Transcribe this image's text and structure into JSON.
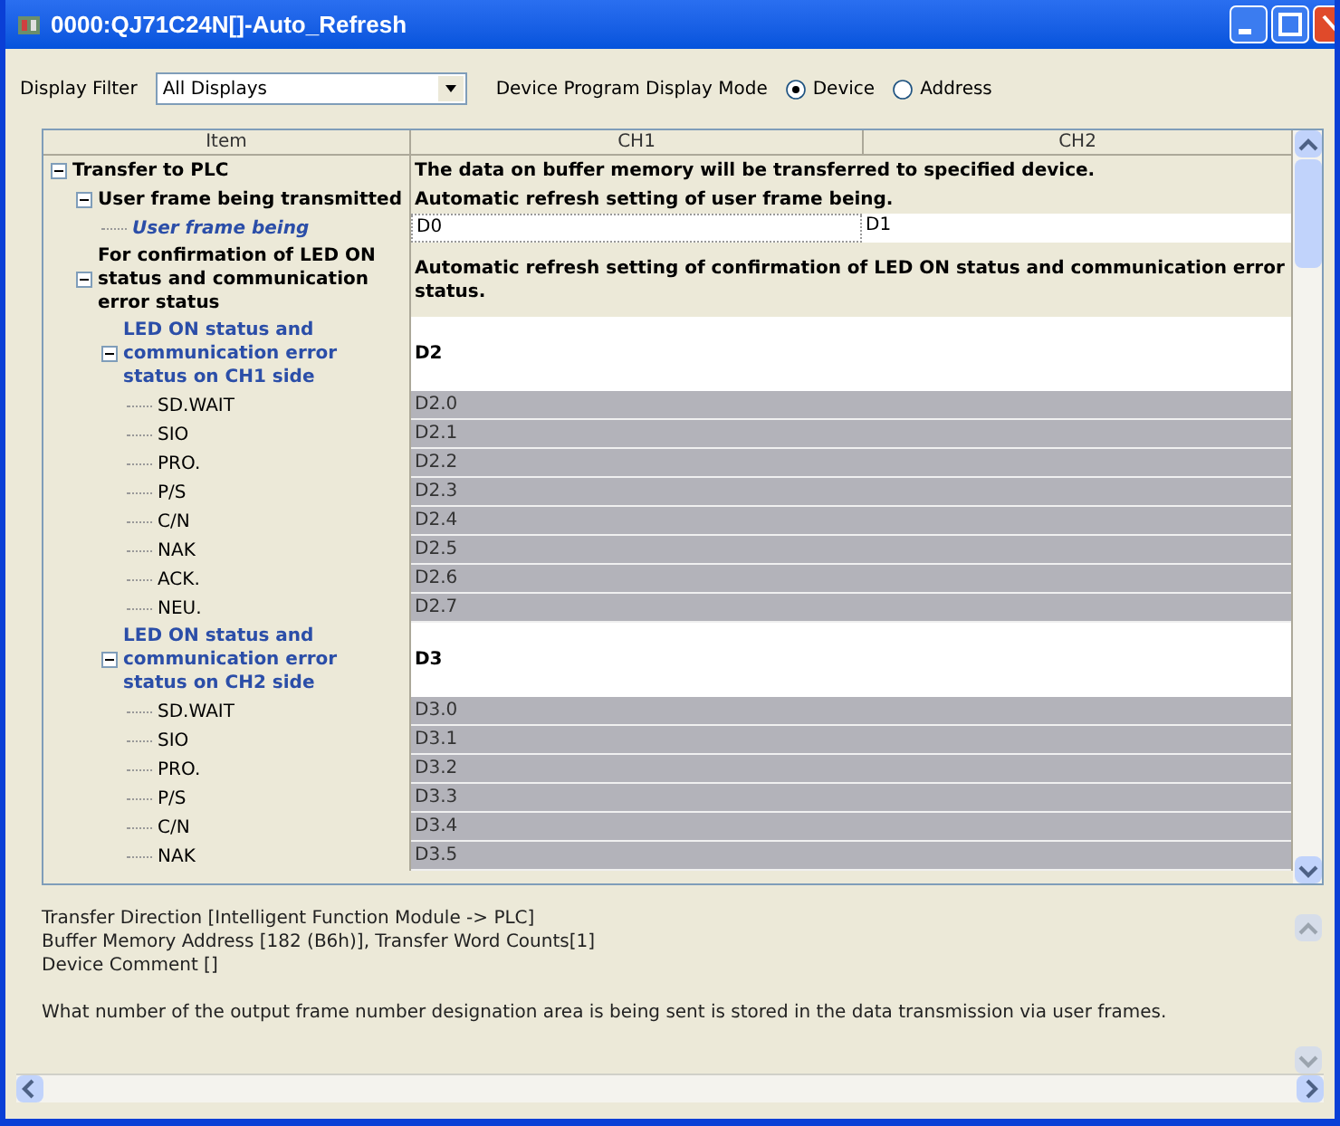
{
  "window": {
    "title": "0000:QJ71C24N[]-Auto_Refresh"
  },
  "filter": {
    "label": "Display Filter",
    "value": "All Displays"
  },
  "display_mode": {
    "label": "Device Program Display Mode",
    "options": [
      {
        "label": "Device",
        "selected": true
      },
      {
        "label": "Address",
        "selected": false
      }
    ]
  },
  "table": {
    "columns": [
      "Item",
      "CH1",
      "CH2"
    ],
    "rows": [
      {
        "kind": "heading",
        "label": "Transfer to PLC",
        "expanded": true,
        "description": "The data on buffer memory will be transferred to specified device.",
        "children": [
          {
            "kind": "heading",
            "label": "User frame being transmitted",
            "expanded": true,
            "description": "Automatic refresh setting of user frame being.",
            "children": [
              {
                "kind": "input",
                "label": "User frame being",
                "ch1": "D0",
                "ch2": "D1"
              }
            ]
          },
          {
            "kind": "heading",
            "label": "For confirmation of LED ON status and communication error status",
            "expanded": true,
            "description": "Automatic refresh setting of confirmation of LED ON status and communication error status.",
            "children": [
              {
                "kind": "device",
                "label": "LED ON status and communication error status on CH1 side",
                "expanded": true,
                "value": "D2",
                "children": [
                  {
                    "kind": "bit",
                    "label": "SD.WAIT",
                    "value": "D2.0"
                  },
                  {
                    "kind": "bit",
                    "label": "SIO",
                    "value": "D2.1"
                  },
                  {
                    "kind": "bit",
                    "label": "PRO.",
                    "value": "D2.2"
                  },
                  {
                    "kind": "bit",
                    "label": "P/S",
                    "value": "D2.3"
                  },
                  {
                    "kind": "bit",
                    "label": "C/N",
                    "value": "D2.4"
                  },
                  {
                    "kind": "bit",
                    "label": "NAK",
                    "value": "D2.5"
                  },
                  {
                    "kind": "bit",
                    "label": "ACK.",
                    "value": "D2.6"
                  },
                  {
                    "kind": "bit",
                    "label": "NEU.",
                    "value": "D2.7"
                  }
                ]
              },
              {
                "kind": "device",
                "label": "LED ON status and communication error status on CH2 side",
                "expanded": true,
                "value": "D3",
                "children": [
                  {
                    "kind": "bit",
                    "label": "SD.WAIT",
                    "value": "D3.0"
                  },
                  {
                    "kind": "bit",
                    "label": "SIO",
                    "value": "D3.1"
                  },
                  {
                    "kind": "bit",
                    "label": "PRO.",
                    "value": "D3.2"
                  },
                  {
                    "kind": "bit",
                    "label": "P/S",
                    "value": "D3.3"
                  },
                  {
                    "kind": "bit",
                    "label": "C/N",
                    "value": "D3.4"
                  },
                  {
                    "kind": "bit",
                    "label": "NAK",
                    "value": "D3.5"
                  }
                ]
              }
            ]
          }
        ]
      }
    ]
  },
  "info": {
    "lines": [
      "Transfer Direction [Intelligent Function Module -> PLC]",
      "Buffer Memory Address [182 (B6h)], Transfer Word Counts[1]",
      "Device Comment []"
    ],
    "explanation": "What number of the output frame number designation area is being sent is stored in the data transmission via user frames."
  }
}
